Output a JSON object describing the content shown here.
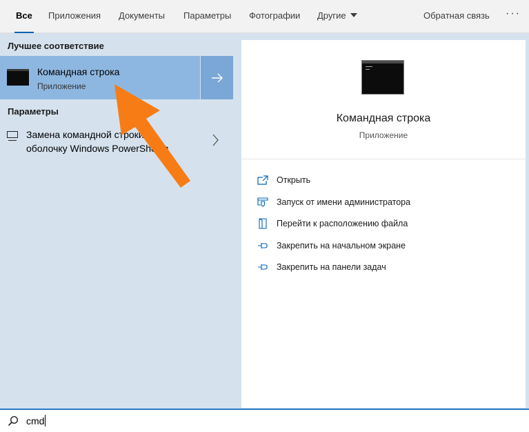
{
  "tabs": [
    {
      "label": "Все",
      "active": true
    },
    {
      "label": "Приложения",
      "active": false
    },
    {
      "label": "Документы",
      "active": false
    },
    {
      "label": "Параметры",
      "active": false
    },
    {
      "label": "Фотографии",
      "active": false
    },
    {
      "label": "Другие",
      "active": false
    }
  ],
  "header": {
    "feedback_label": "Обратная связь",
    "more_label": "···"
  },
  "results": {
    "best_match_heading": "Лучшее соответствие",
    "best_match": {
      "title": "Командная строка",
      "subtitle": "Приложение",
      "icon": "command-prompt-icon",
      "open_arrow_icon": "arrow-right-icon"
    },
    "settings_heading": "Параметры",
    "settings_items": [
      {
        "line1": "Замена командной строки на",
        "line2": "оболочку Windows PowerShell в",
        "icon": "monitor-icon"
      }
    ]
  },
  "preview": {
    "title": "Командная строка",
    "subtitle": "Приложение",
    "actions": [
      {
        "label": "Открыть",
        "icon": "open-icon"
      },
      {
        "label": "Запуск от имени администратора",
        "icon": "shield-run-icon"
      },
      {
        "label": "Перейти к расположению файла",
        "icon": "file-location-icon"
      },
      {
        "label": "Закрепить на начальном экране",
        "icon": "pin-icon"
      },
      {
        "label": "Закрепить на панели задач",
        "icon": "pin-icon"
      }
    ]
  },
  "search": {
    "value": "cmd",
    "icon": "search-icon"
  },
  "colors": {
    "accent": "#0063b1",
    "selected": "#8db7e0",
    "annotation_arrow": "#f77c15"
  }
}
